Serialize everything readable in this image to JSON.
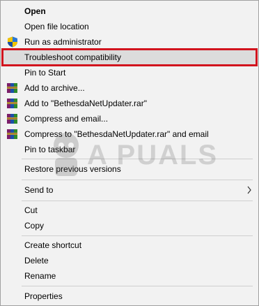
{
  "menu": {
    "items": {
      "open": "Open",
      "open_file_location": "Open file location",
      "run_as_admin": "Run as administrator",
      "troubleshoot": "Troubleshoot compatibility",
      "pin_to_start": "Pin to Start",
      "add_to_archive": "Add to archive...",
      "add_to_rar": "Add to \"BethesdaNetUpdater.rar\"",
      "compress_email": "Compress and email...",
      "compress_rar_email": "Compress to \"BethesdaNetUpdater.rar\" and email",
      "pin_to_taskbar": "Pin to taskbar",
      "restore_versions": "Restore previous versions",
      "send_to": "Send to",
      "cut": "Cut",
      "copy": "Copy",
      "create_shortcut": "Create shortcut",
      "delete": "Delete",
      "rename": "Rename",
      "properties": "Properties"
    },
    "icons": {
      "run_as_admin": "uac-shield-icon",
      "archive": "winrar-books-icon",
      "submenu": "chevron-right-icon"
    },
    "colors": {
      "highlight_border": "#d2141e",
      "highlight_fill": "#dcdcdc",
      "menu_bg": "#f2f2f2"
    }
  },
  "watermark": {
    "text": "A PUALS"
  }
}
